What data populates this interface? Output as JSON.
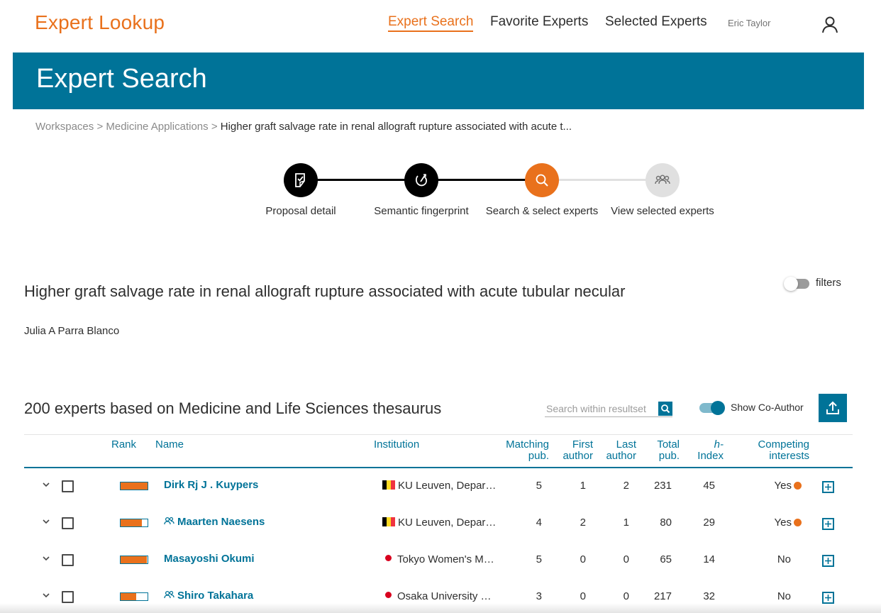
{
  "nav": {
    "logo": "Expert Lookup",
    "links": [
      "Expert Search",
      "Favorite Experts",
      "Selected Experts"
    ],
    "user_name": "Eric Taylor",
    "user_icon": "user-icon"
  },
  "banner": {
    "title": "Expert Search"
  },
  "breadcrumb": {
    "items": [
      "Workspaces",
      "Medicine Applications"
    ],
    "separator": ">",
    "current": "Higher graft salvage rate in renal allograft rupture associated with acute t..."
  },
  "stepper": {
    "steps": [
      {
        "label": "Proposal detail",
        "icon": "proposal-icon",
        "state": "done"
      },
      {
        "label": "Semantic fingerprint",
        "icon": "fingerprint-icon",
        "state": "done"
      },
      {
        "label": "Search & select experts",
        "icon": "search-icon",
        "state": "active"
      },
      {
        "label": "View selected experts",
        "icon": "people-icon",
        "state": "todo"
      }
    ]
  },
  "proposal": {
    "title": "Higher graft salvage rate in renal allograft rupture associated with acute tubular necular",
    "author": "Julia A Parra Blanco",
    "filters_label": "filters",
    "filters_on": false
  },
  "results": {
    "title": "200 experts based on Medicine and Life Sciences thesaurus",
    "search_placeholder": "Search within resultset",
    "coauthor_label": "Show Co-Author",
    "coauthor_on": true,
    "export_icon": "export-icon"
  },
  "table": {
    "headers": {
      "rank": "Rank",
      "name": "Name",
      "institution": "Institution",
      "matching_1": "Matching",
      "matching_2": "pub.",
      "first_1": "First",
      "first_2": "author",
      "last_1": "Last",
      "last_2": "author",
      "total_1": "Total",
      "total_2": "pub.",
      "h_1": "h-",
      "h_2": "Index",
      "ci_1": "Competing",
      "ci_2": "interests"
    },
    "rows": [
      {
        "rank_fill": 1.0,
        "name": "Dirk Rj J . Kuypers",
        "coauthor": false,
        "flag": "belgium",
        "institution": "KU Leuven, Department of Microbiology and Immunology",
        "matching": "5",
        "first": "1",
        "last": "2",
        "total": "231",
        "h": "45",
        "ci": "Yes",
        "ci_flag": true
      },
      {
        "rank_fill": 0.78,
        "name": "Maarten Naesens",
        "coauthor": true,
        "flag": "belgium",
        "institution": "KU Leuven, Department of Microbiology and Immunology",
        "matching": "4",
        "first": "2",
        "last": "1",
        "total": "80",
        "h": "29",
        "ci": "Yes",
        "ci_flag": true
      },
      {
        "rank_fill": 0.97,
        "name": "Masayoshi Okumi",
        "coauthor": false,
        "flag": "japan",
        "institution": "Tokyo Women's Medical University",
        "matching": "5",
        "first": "0",
        "last": "0",
        "total": "65",
        "h": "14",
        "ci": "No",
        "ci_flag": false
      },
      {
        "rank_fill": 0.58,
        "name": "Shiro Takahara",
        "coauthor": true,
        "flag": "japan",
        "institution": "Osaka University Faculty of Medicine",
        "matching": "3",
        "first": "0",
        "last": "0",
        "total": "217",
        "h": "32",
        "ci": "No",
        "ci_flag": false
      }
    ]
  },
  "colors": {
    "accent": "#e9711c",
    "brand": "#007398",
    "text": "#2e2e2e"
  }
}
